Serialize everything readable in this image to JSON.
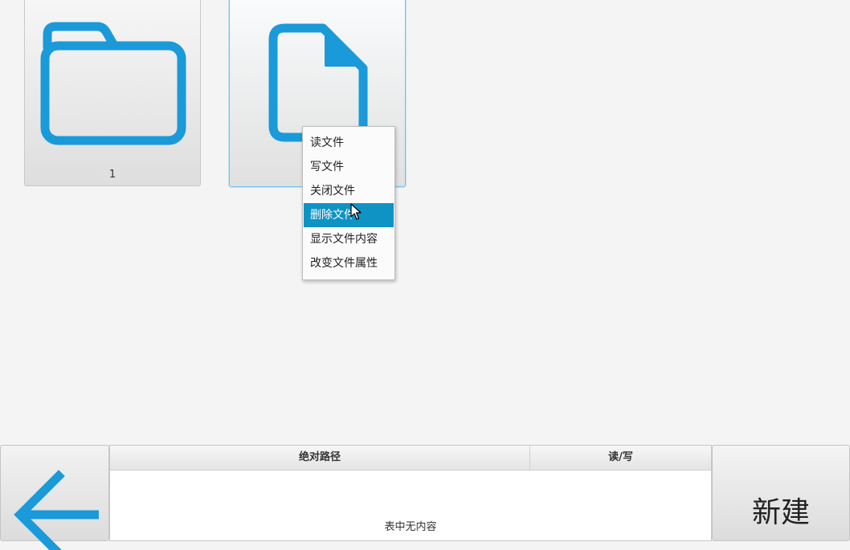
{
  "colors": {
    "accent": "#1a9ad9",
    "menu_highlight": "#0f93c5"
  },
  "tiles": [
    {
      "icon": "folder-icon",
      "label": "1"
    },
    {
      "icon": "file-icon",
      "label": ""
    }
  ],
  "context_menu": {
    "items": [
      {
        "label": "读文件"
      },
      {
        "label": "写文件"
      },
      {
        "label": "关闭文件"
      },
      {
        "label": "删除文件",
        "highlighted": true
      },
      {
        "label": "显示文件内容"
      },
      {
        "label": "改变文件属性"
      }
    ]
  },
  "bottom": {
    "back_icon": "arrow-left-icon",
    "table": {
      "columns": [
        "绝对路径",
        "读/写"
      ],
      "empty_text": "表中无内容"
    },
    "new_button_label": "新建"
  }
}
